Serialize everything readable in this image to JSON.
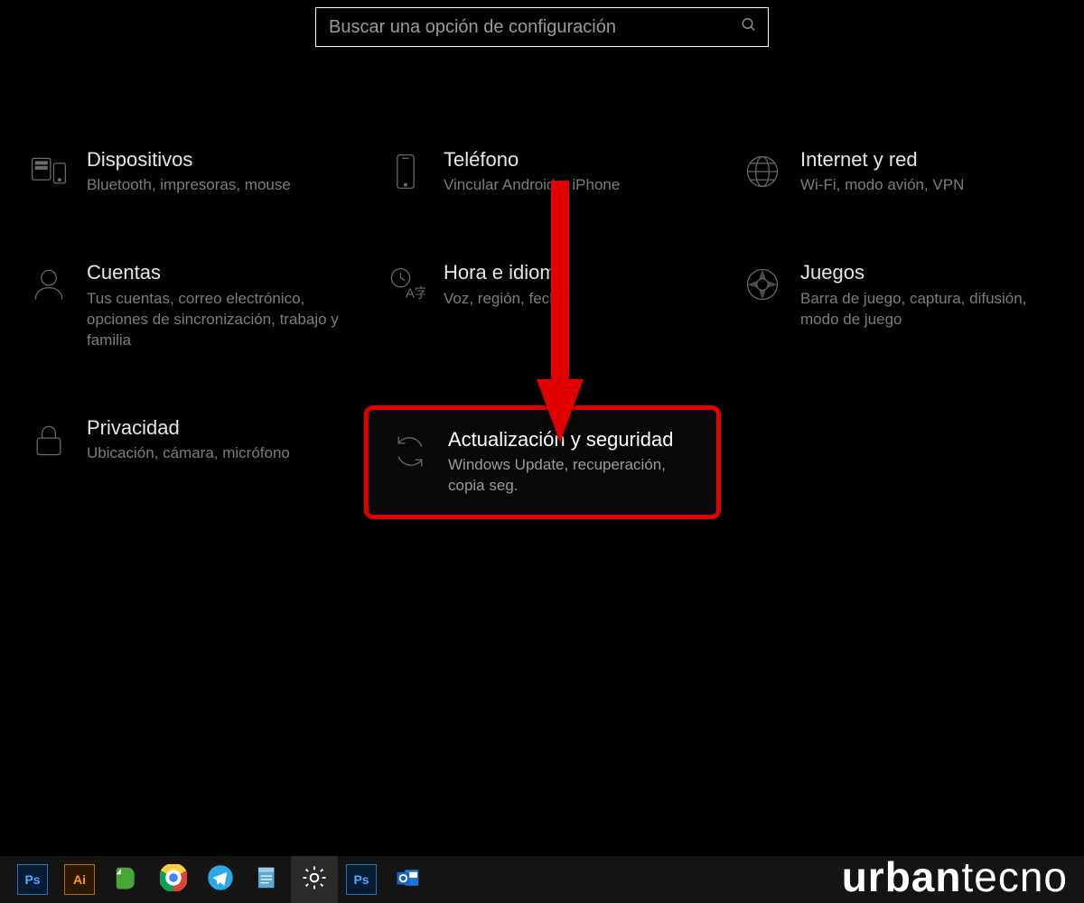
{
  "search": {
    "placeholder": "Buscar una opción de configuración"
  },
  "tiles": [
    {
      "icon": "devices",
      "title": "Dispositivos",
      "sub": "Bluetooth, impresoras, mouse"
    },
    {
      "icon": "phone",
      "title": "Teléfono",
      "sub": "Vincular Android o iPhone"
    },
    {
      "icon": "globe",
      "title": "Internet y red",
      "sub": "Wi-Fi, modo avión, VPN"
    },
    {
      "icon": "account",
      "title": "Cuentas",
      "sub": "Tus cuentas, correo electrónico, opciones de sincronización, trabajo y familia"
    },
    {
      "icon": "time-lang",
      "title": "Hora e idioma",
      "sub": "Voz, región, fecha"
    },
    {
      "icon": "gaming",
      "title": "Juegos",
      "sub": "Barra de juego, captura, difusión, modo de juego"
    },
    {
      "icon": "privacy",
      "title": "Privacidad",
      "sub": "Ubicación, cámara, micrófono"
    },
    {
      "icon": "update",
      "title": "Actualización y seguridad",
      "sub": "Windows Update, recuperación, copia seg.",
      "highlight": true
    }
  ],
  "taskbar": {
    "items": [
      {
        "name": "photoshop",
        "label": "Ps",
        "bg": "#071c33",
        "fg": "#4fa8ff",
        "border": "#2a6fb0"
      },
      {
        "name": "illustrator",
        "label": "Ai",
        "bg": "#2a1700",
        "fg": "#ff9a00",
        "border": "#b86b00"
      },
      {
        "name": "evernote",
        "icon": "evernote"
      },
      {
        "name": "chrome",
        "icon": "chrome"
      },
      {
        "name": "telegram",
        "icon": "telegram"
      },
      {
        "name": "notepad",
        "icon": "notepad"
      },
      {
        "name": "settings",
        "icon": "gear",
        "active": true
      },
      {
        "name": "photoshop-2",
        "label": "Ps",
        "bg": "#071c33",
        "fg": "#4fa8ff",
        "border": "#2a6fb0"
      },
      {
        "name": "outlook",
        "icon": "outlook"
      }
    ]
  },
  "watermark": {
    "bold": "urban",
    "light": "tecno"
  }
}
